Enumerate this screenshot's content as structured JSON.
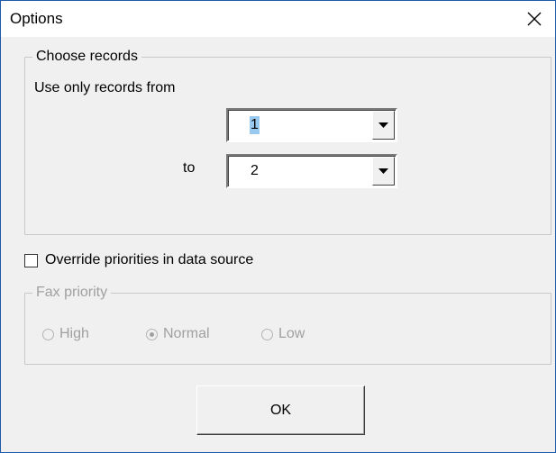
{
  "window": {
    "title": "Options",
    "close_icon": "close-icon"
  },
  "choose_records": {
    "legend": "Choose records",
    "use_only_label": "Use only records from",
    "to_label": "to",
    "from_value": "1",
    "to_value": "2"
  },
  "override": {
    "label": "Override priorities in data source",
    "checked": false
  },
  "fax_priority": {
    "legend": "Fax priority",
    "options": [
      {
        "label": "High",
        "selected": false
      },
      {
        "label": "Normal",
        "selected": true
      },
      {
        "label": "Low",
        "selected": false
      }
    ],
    "enabled": false
  },
  "buttons": {
    "ok_label": "OK"
  },
  "colors": {
    "window_border": "#1d5aa8",
    "dialog_bg": "#f0f0f0",
    "selection_bg": "#99c9ef",
    "disabled_text": "#a0a0a0"
  }
}
